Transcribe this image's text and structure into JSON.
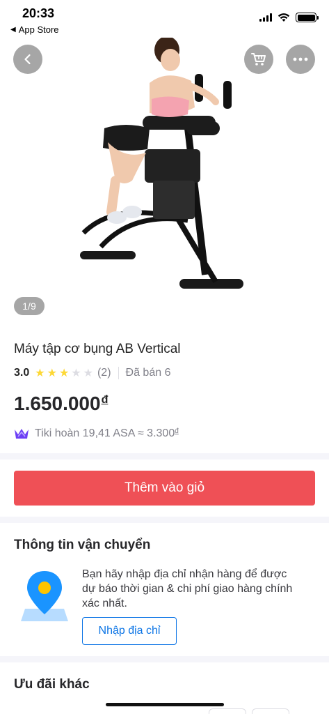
{
  "status_bar": {
    "time": "20:33",
    "back_label": "App Store"
  },
  "gallery": {
    "image_counter": "1/9",
    "icons": [
      "chevron-left-icon",
      "cart-icon",
      "more-icon"
    ]
  },
  "product": {
    "name": "Máy tập cơ bụng AB Vertical",
    "rating": "3.0",
    "stars_filled": 3,
    "stars_total": 5,
    "review_count": "(2)",
    "sold": "Đã bán 6",
    "price": "1.650.000",
    "currency": "đ",
    "cashback": "Tiki hoàn 19,41 ASA ≈ 3.300",
    "cashback_currency": "đ"
  },
  "actions": {
    "add_to_cart": "Thêm vào giỏ"
  },
  "shipping": {
    "title": "Thông tin vận chuyển",
    "description": "Bạn hãy nhập địa chỉ nhận hàng để được dự báo thời gian & chi phí giao hàng chính xác nhất.",
    "address_button": "Nhập địa chỉ"
  },
  "other_offers": {
    "title": "Ưu đãi khác"
  },
  "colors": {
    "primary_red": "#ef5056",
    "link_blue": "#0b74e5",
    "star_yellow": "#fdd836"
  }
}
